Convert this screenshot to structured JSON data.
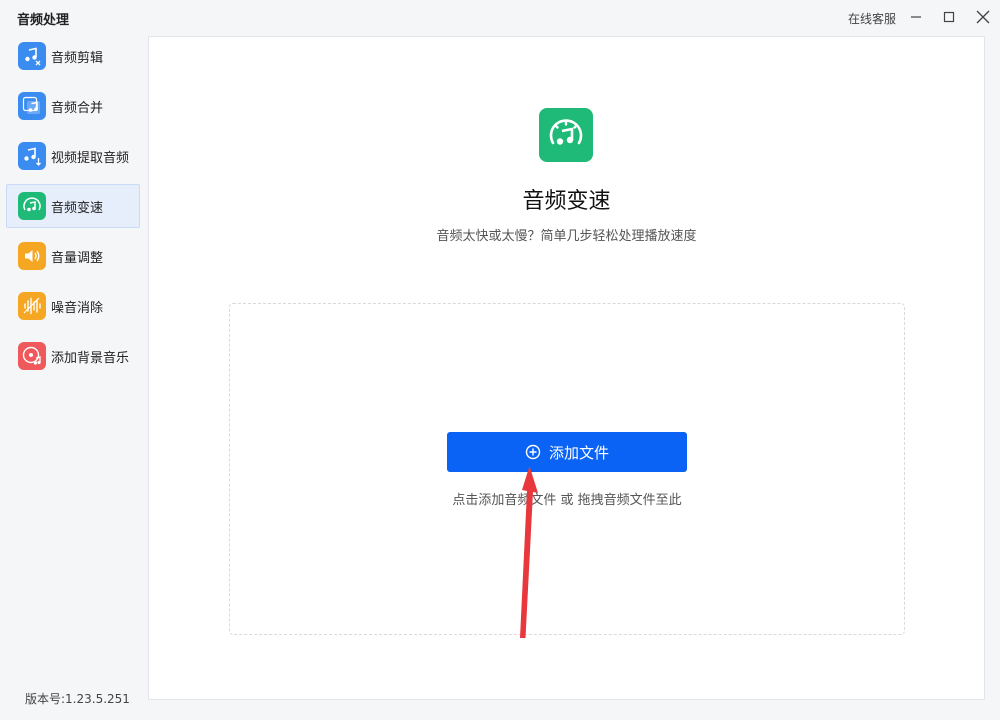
{
  "window": {
    "title": "音频处理",
    "support_label": "在线客服"
  },
  "sidebar": {
    "items": [
      {
        "label": "音频剪辑",
        "icon": "music-scissors-icon",
        "color": "#3b8cf0"
      },
      {
        "label": "音频合并",
        "icon": "music-stack-icon",
        "color": "#3b8cf0"
      },
      {
        "label": "视频提取音频",
        "icon": "music-extract-icon",
        "color": "#3b8cf0"
      },
      {
        "label": "音频变速",
        "icon": "music-speed-icon",
        "color": "#1fba78",
        "active": true
      },
      {
        "label": "音量调整",
        "icon": "speaker-volume-icon",
        "color": "#f5a623"
      },
      {
        "label": "噪音消除",
        "icon": "waveform-noise-icon",
        "color": "#f5a623"
      },
      {
        "label": "添加背景音乐",
        "icon": "disc-music-icon",
        "color": "#f0595b"
      }
    ],
    "version": "版本号:1.23.5.251"
  },
  "main": {
    "icon": "music-speed-icon",
    "accent": "#1fba78",
    "title": "音频变速",
    "description": "音频太快或太慢？简单几步轻松处理播放速度",
    "add_button_label": "添加文件",
    "drop_hint": "点击添加音频文件 或 拖拽音频文件至此",
    "button_color": "#0b63f6",
    "annotation_arrow_color": "#e8383d"
  }
}
